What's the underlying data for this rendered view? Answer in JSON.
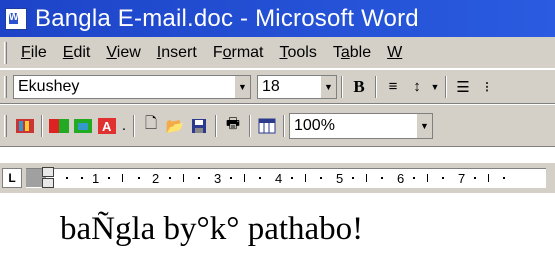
{
  "window": {
    "title": "Bangla E-mail.doc - Microsoft Word"
  },
  "menu": {
    "items": [
      "File",
      "Edit",
      "View",
      "Insert",
      "Format",
      "Tools",
      "Table",
      "W"
    ],
    "mnemonics": [
      "F",
      "E",
      "V",
      "I",
      "o",
      "T",
      "a",
      "W"
    ]
  },
  "formatting": {
    "font_name": "Ekushey",
    "font_size": "18",
    "bold_label": "B"
  },
  "standard": {
    "zoom": "100%"
  },
  "ruler": {
    "tab_selector": "L",
    "numbers": [
      "1",
      "2",
      "3",
      "4",
      "5",
      "6",
      "7"
    ]
  },
  "document": {
    "text": "baÑgla by°k° pathabo!"
  }
}
